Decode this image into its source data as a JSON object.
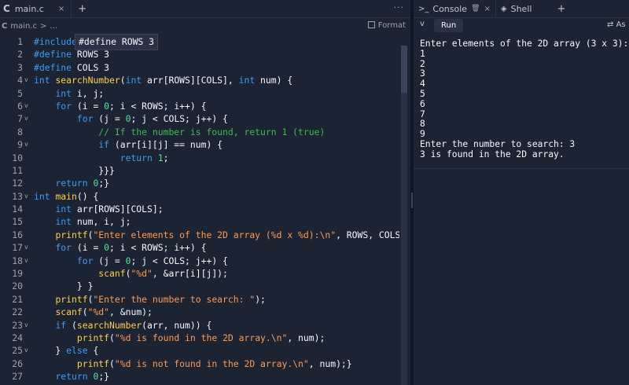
{
  "editor": {
    "tab": {
      "logo": "C",
      "title": "main.c",
      "close": "×"
    },
    "new_tab": "+",
    "more": "···",
    "breadcrumb": {
      "logo": "C",
      "file": "main.c",
      "sep": ">",
      "rest": "..."
    },
    "format_label": "Format",
    "tooltip": "#define ROWS 3",
    "lines": [
      {
        "n": "1",
        "fold": "",
        "tokens": [
          [
            "#include",
            "kw"
          ]
        ]
      },
      {
        "n": "2",
        "fold": "",
        "tokens": [
          [
            "#define",
            "kw"
          ],
          [
            " ROWS ",
            "pl"
          ],
          [
            "3",
            "pl"
          ]
        ]
      },
      {
        "n": "3",
        "fold": "",
        "tokens": [
          [
            "#define",
            "kw"
          ],
          [
            " COLS ",
            "pl"
          ],
          [
            "3",
            "pl"
          ]
        ]
      },
      {
        "n": "4",
        "fold": "v",
        "tokens": [
          [
            "int",
            "kw"
          ],
          [
            " ",
            "pl"
          ],
          [
            "searchNumber",
            "fn"
          ],
          [
            "(",
            "pl"
          ],
          [
            "int",
            "kw"
          ],
          [
            " arr[ROWS][COLS], ",
            "pl"
          ],
          [
            "int",
            "kw"
          ],
          [
            " num) {",
            "pl"
          ]
        ]
      },
      {
        "n": "5",
        "fold": "",
        "tokens": [
          [
            "    ",
            "pl"
          ],
          [
            "int",
            "kw"
          ],
          [
            " i, j;",
            "pl"
          ]
        ]
      },
      {
        "n": "6",
        "fold": "v",
        "tokens": [
          [
            "    ",
            "pl"
          ],
          [
            "for",
            "kw"
          ],
          [
            " (i = ",
            "pl"
          ],
          [
            "0",
            "num"
          ],
          [
            "; i < ROWS; i++) {",
            "pl"
          ]
        ]
      },
      {
        "n": "7",
        "fold": "v",
        "tokens": [
          [
            "        ",
            "pl"
          ],
          [
            "for",
            "kw"
          ],
          [
            " (j = ",
            "pl"
          ],
          [
            "0",
            "num"
          ],
          [
            "; j < COLS; j++) {",
            "pl"
          ]
        ]
      },
      {
        "n": "8",
        "fold": "",
        "tokens": [
          [
            "            ",
            "pl"
          ],
          [
            "// If the number is found, return 1 (true)",
            "cm"
          ]
        ]
      },
      {
        "n": "9",
        "fold": "v",
        "tokens": [
          [
            "            ",
            "pl"
          ],
          [
            "if",
            "kw"
          ],
          [
            " (arr[i][j] == num) {",
            "pl"
          ]
        ]
      },
      {
        "n": "10",
        "fold": "",
        "tokens": [
          [
            "                ",
            "pl"
          ],
          [
            "return",
            "kw"
          ],
          [
            " ",
            "pl"
          ],
          [
            "1",
            "num"
          ],
          [
            ";",
            "pl"
          ]
        ]
      },
      {
        "n": "11",
        "fold": "",
        "tokens": [
          [
            "            }}}",
            "pl"
          ]
        ]
      },
      {
        "n": "12",
        "fold": "",
        "tokens": [
          [
            "    ",
            "pl"
          ],
          [
            "return",
            "kw"
          ],
          [
            " ",
            "pl"
          ],
          [
            "0",
            "num"
          ],
          [
            ";}",
            "pl"
          ]
        ]
      },
      {
        "n": "13",
        "fold": "v",
        "tokens": [
          [
            "int",
            "kw"
          ],
          [
            " ",
            "pl"
          ],
          [
            "main",
            "fn"
          ],
          [
            "() {",
            "pl"
          ]
        ]
      },
      {
        "n": "14",
        "fold": "",
        "tokens": [
          [
            "    ",
            "pl"
          ],
          [
            "int",
            "kw"
          ],
          [
            " arr[ROWS][COLS];",
            "pl"
          ]
        ]
      },
      {
        "n": "15",
        "fold": "",
        "tokens": [
          [
            "    ",
            "pl"
          ],
          [
            "int",
            "kw"
          ],
          [
            " num, i, j;",
            "pl"
          ]
        ]
      },
      {
        "n": "16",
        "fold": "",
        "tokens": [
          [
            "    ",
            "pl"
          ],
          [
            "printf",
            "fn"
          ],
          [
            "(",
            "pl"
          ],
          [
            "\"Enter elements of the 2D array (%d x %d):\\n\"",
            "str"
          ],
          [
            ", ROWS, COLS);",
            "pl"
          ]
        ]
      },
      {
        "n": "17",
        "fold": "v",
        "tokens": [
          [
            "    ",
            "pl"
          ],
          [
            "for",
            "kw"
          ],
          [
            " (i = ",
            "pl"
          ],
          [
            "0",
            "num"
          ],
          [
            "; i < ROWS; i++) {",
            "pl"
          ]
        ]
      },
      {
        "n": "18",
        "fold": "v",
        "tokens": [
          [
            "        ",
            "pl"
          ],
          [
            "for",
            "kw"
          ],
          [
            " (j = ",
            "pl"
          ],
          [
            "0",
            "num"
          ],
          [
            "; j < COLS; j++) {",
            "pl"
          ]
        ]
      },
      {
        "n": "19",
        "fold": "",
        "tokens": [
          [
            "            ",
            "pl"
          ],
          [
            "scanf",
            "fn"
          ],
          [
            "(",
            "pl"
          ],
          [
            "\"%d\"",
            "str"
          ],
          [
            ", &arr[i][j]);",
            "pl"
          ]
        ]
      },
      {
        "n": "20",
        "fold": "",
        "tokens": [
          [
            "        } }",
            "pl"
          ]
        ]
      },
      {
        "n": "21",
        "fold": "",
        "tokens": [
          [
            "    ",
            "pl"
          ],
          [
            "printf",
            "fn"
          ],
          [
            "(",
            "pl"
          ],
          [
            "\"Enter the number to search: \"",
            "str"
          ],
          [
            ");",
            "pl"
          ]
        ]
      },
      {
        "n": "22",
        "fold": "",
        "tokens": [
          [
            "    ",
            "pl"
          ],
          [
            "scanf",
            "fn"
          ],
          [
            "(",
            "pl"
          ],
          [
            "\"%d\"",
            "str"
          ],
          [
            ", &num);",
            "pl"
          ]
        ]
      },
      {
        "n": "23",
        "fold": "v",
        "tokens": [
          [
            "    ",
            "pl"
          ],
          [
            "if",
            "kw"
          ],
          [
            " (",
            "pl"
          ],
          [
            "searchNumber",
            "fn"
          ],
          [
            "(arr, num)) {",
            "pl"
          ]
        ]
      },
      {
        "n": "24",
        "fold": "",
        "tokens": [
          [
            "        ",
            "pl"
          ],
          [
            "printf",
            "fn"
          ],
          [
            "(",
            "pl"
          ],
          [
            "\"%d is found in the 2D array.\\n\"",
            "str"
          ],
          [
            ", num);",
            "pl"
          ]
        ]
      },
      {
        "n": "25",
        "fold": "v",
        "tokens": [
          [
            "    } ",
            "pl"
          ],
          [
            "else",
            "kw"
          ],
          [
            " {",
            "pl"
          ]
        ]
      },
      {
        "n": "26",
        "fold": "",
        "tokens": [
          [
            "        ",
            "pl"
          ],
          [
            "printf",
            "fn"
          ],
          [
            "(",
            "pl"
          ],
          [
            "\"%d is not found in the 2D array.\\n\"",
            "str"
          ],
          [
            ", num);}",
            "pl"
          ]
        ]
      },
      {
        "n": "27",
        "fold": "",
        "tokens": [
          [
            "    ",
            "pl"
          ],
          [
            "return",
            "kw"
          ],
          [
            " ",
            "pl"
          ],
          [
            "0",
            "num"
          ],
          [
            ";}",
            "pl"
          ]
        ]
      }
    ]
  },
  "console": {
    "tabs": [
      {
        "icon": ">_",
        "label": "Console",
        "trash": "🗑",
        "close": "×"
      },
      {
        "icon": "◈",
        "label": "Shell"
      }
    ],
    "new_tab": "+",
    "chevron": "v",
    "run_label": "Run",
    "ask_label": "As",
    "output": "Enter elements of the 2D array (3 x 3):\n1\n2\n3\n4\n5\n6\n7\n8\n9\nEnter the number to search: 3\n3 is found in the 2D array."
  },
  "colors": {
    "bg": "#1c2333",
    "keyword": "#3b9cf5",
    "function": "#ffcf4f",
    "string": "#ff9a52",
    "number": "#57e39a",
    "comment": "#3fb950"
  }
}
